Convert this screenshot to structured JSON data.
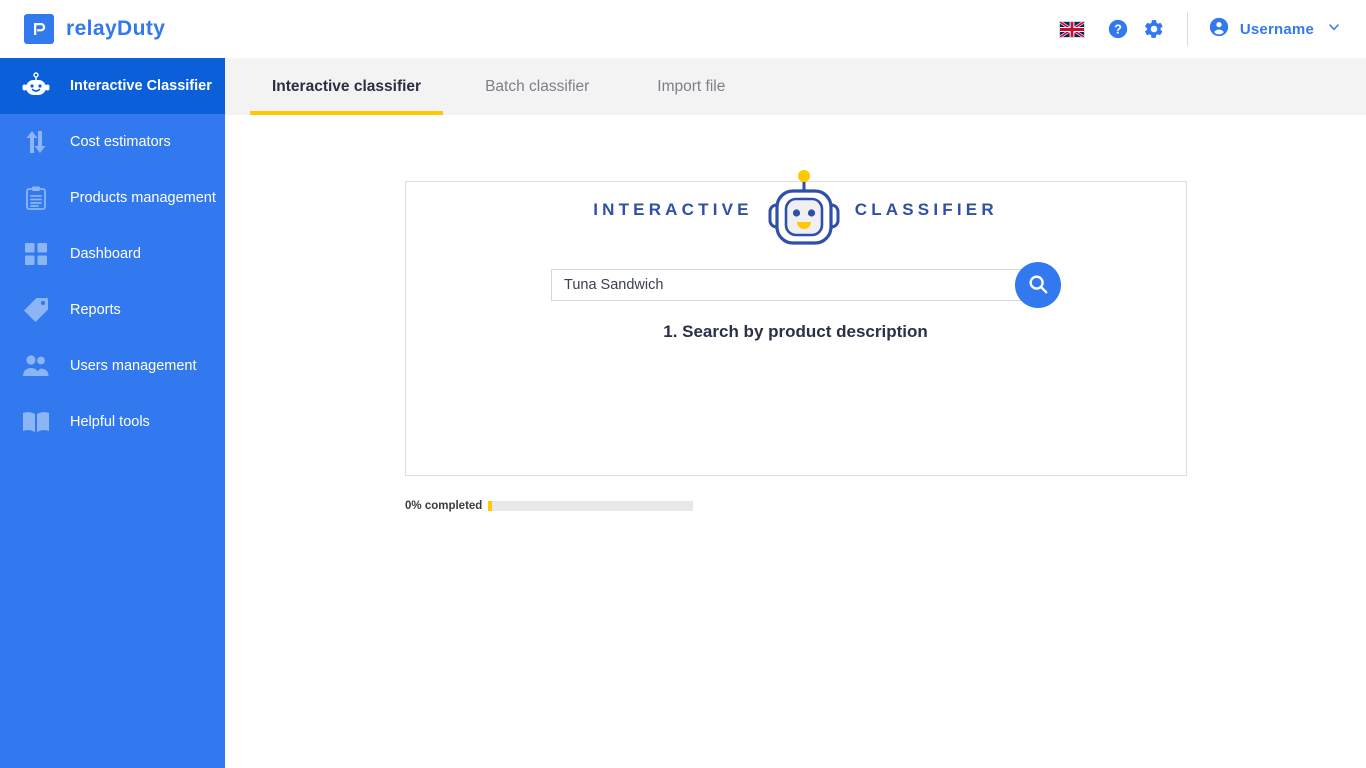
{
  "header": {
    "brand_name": "relayDuty",
    "logo_icon": "relayduty-logo-icon",
    "language_flag": "uk-flag-icon",
    "help_icon": "help-circle-icon",
    "settings_icon": "gear-icon",
    "avatar_icon": "account-circle-icon",
    "user_name": "Username",
    "chevron_icon": "chevron-down-icon"
  },
  "sidebar": {
    "items": [
      {
        "label": "Interactive Classifier",
        "icon": "robot-icon",
        "active": true
      },
      {
        "label": "Cost estimators",
        "icon": "exchange-arrows-icon",
        "active": false
      },
      {
        "label": "Products management",
        "icon": "clipboard-icon",
        "active": false
      },
      {
        "label": "Dashboard",
        "icon": "grid-squares-icon",
        "active": false
      },
      {
        "label": "Reports",
        "icon": "tag-icon",
        "active": false
      },
      {
        "label": "Users management",
        "icon": "users-icon",
        "active": false
      },
      {
        "label": "Helpful tools",
        "icon": "book-icon",
        "active": false
      }
    ]
  },
  "tabs": [
    {
      "label": "Interactive classifier",
      "active": true
    },
    {
      "label": "Batch classifier",
      "active": false
    },
    {
      "label": "Import file",
      "active": false
    }
  ],
  "main": {
    "title_left": "INTERACTIVE",
    "title_right": "CLASSIFIER",
    "robot_icon": "robot-mascot-icon",
    "search": {
      "value": "Tuna Sandwich",
      "placeholder": "",
      "button_icon": "search-icon"
    },
    "step_label": "1. Search by product description",
    "progress": {
      "label": "0% completed",
      "percent": 0
    }
  },
  "colors": {
    "brand_blue": "#3279EF",
    "sidebar_active": "#0B5FD9",
    "accent_yellow": "#FFC800",
    "title_navy": "#2F4FA8",
    "tabbar_bg": "#F3F3F3",
    "card_border": "#DEDEDE"
  }
}
